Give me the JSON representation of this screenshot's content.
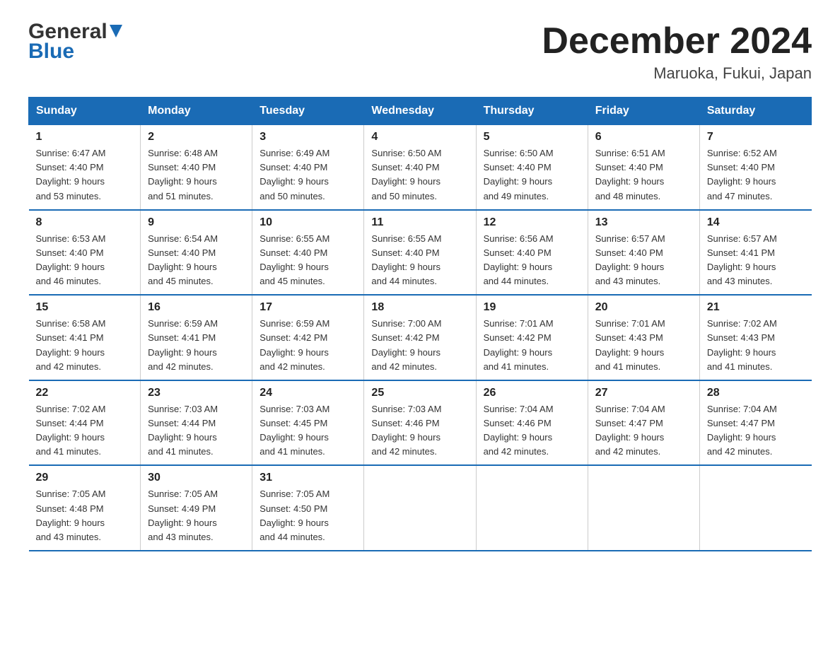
{
  "logo": {
    "general": "General",
    "blue": "Blue"
  },
  "title": "December 2024",
  "location": "Maruoka, Fukui, Japan",
  "days_of_week": [
    "Sunday",
    "Monday",
    "Tuesday",
    "Wednesday",
    "Thursday",
    "Friday",
    "Saturday"
  ],
  "weeks": [
    [
      {
        "day": "1",
        "sunrise": "6:47 AM",
        "sunset": "4:40 PM",
        "daylight": "9 hours and 53 minutes."
      },
      {
        "day": "2",
        "sunrise": "6:48 AM",
        "sunset": "4:40 PM",
        "daylight": "9 hours and 51 minutes."
      },
      {
        "day": "3",
        "sunrise": "6:49 AM",
        "sunset": "4:40 PM",
        "daylight": "9 hours and 50 minutes."
      },
      {
        "day": "4",
        "sunrise": "6:50 AM",
        "sunset": "4:40 PM",
        "daylight": "9 hours and 50 minutes."
      },
      {
        "day": "5",
        "sunrise": "6:50 AM",
        "sunset": "4:40 PM",
        "daylight": "9 hours and 49 minutes."
      },
      {
        "day": "6",
        "sunrise": "6:51 AM",
        "sunset": "4:40 PM",
        "daylight": "9 hours and 48 minutes."
      },
      {
        "day": "7",
        "sunrise": "6:52 AM",
        "sunset": "4:40 PM",
        "daylight": "9 hours and 47 minutes."
      }
    ],
    [
      {
        "day": "8",
        "sunrise": "6:53 AM",
        "sunset": "4:40 PM",
        "daylight": "9 hours and 46 minutes."
      },
      {
        "day": "9",
        "sunrise": "6:54 AM",
        "sunset": "4:40 PM",
        "daylight": "9 hours and 45 minutes."
      },
      {
        "day": "10",
        "sunrise": "6:55 AM",
        "sunset": "4:40 PM",
        "daylight": "9 hours and 45 minutes."
      },
      {
        "day": "11",
        "sunrise": "6:55 AM",
        "sunset": "4:40 PM",
        "daylight": "9 hours and 44 minutes."
      },
      {
        "day": "12",
        "sunrise": "6:56 AM",
        "sunset": "4:40 PM",
        "daylight": "9 hours and 44 minutes."
      },
      {
        "day": "13",
        "sunrise": "6:57 AM",
        "sunset": "4:40 PM",
        "daylight": "9 hours and 43 minutes."
      },
      {
        "day": "14",
        "sunrise": "6:57 AM",
        "sunset": "4:41 PM",
        "daylight": "9 hours and 43 minutes."
      }
    ],
    [
      {
        "day": "15",
        "sunrise": "6:58 AM",
        "sunset": "4:41 PM",
        "daylight": "9 hours and 42 minutes."
      },
      {
        "day": "16",
        "sunrise": "6:59 AM",
        "sunset": "4:41 PM",
        "daylight": "9 hours and 42 minutes."
      },
      {
        "day": "17",
        "sunrise": "6:59 AM",
        "sunset": "4:42 PM",
        "daylight": "9 hours and 42 minutes."
      },
      {
        "day": "18",
        "sunrise": "7:00 AM",
        "sunset": "4:42 PM",
        "daylight": "9 hours and 42 minutes."
      },
      {
        "day": "19",
        "sunrise": "7:01 AM",
        "sunset": "4:42 PM",
        "daylight": "9 hours and 41 minutes."
      },
      {
        "day": "20",
        "sunrise": "7:01 AM",
        "sunset": "4:43 PM",
        "daylight": "9 hours and 41 minutes."
      },
      {
        "day": "21",
        "sunrise": "7:02 AM",
        "sunset": "4:43 PM",
        "daylight": "9 hours and 41 minutes."
      }
    ],
    [
      {
        "day": "22",
        "sunrise": "7:02 AM",
        "sunset": "4:44 PM",
        "daylight": "9 hours and 41 minutes."
      },
      {
        "day": "23",
        "sunrise": "7:03 AM",
        "sunset": "4:44 PM",
        "daylight": "9 hours and 41 minutes."
      },
      {
        "day": "24",
        "sunrise": "7:03 AM",
        "sunset": "4:45 PM",
        "daylight": "9 hours and 41 minutes."
      },
      {
        "day": "25",
        "sunrise": "7:03 AM",
        "sunset": "4:46 PM",
        "daylight": "9 hours and 42 minutes."
      },
      {
        "day": "26",
        "sunrise": "7:04 AM",
        "sunset": "4:46 PM",
        "daylight": "9 hours and 42 minutes."
      },
      {
        "day": "27",
        "sunrise": "7:04 AM",
        "sunset": "4:47 PM",
        "daylight": "9 hours and 42 minutes."
      },
      {
        "day": "28",
        "sunrise": "7:04 AM",
        "sunset": "4:47 PM",
        "daylight": "9 hours and 42 minutes."
      }
    ],
    [
      {
        "day": "29",
        "sunrise": "7:05 AM",
        "sunset": "4:48 PM",
        "daylight": "9 hours and 43 minutes."
      },
      {
        "day": "30",
        "sunrise": "7:05 AM",
        "sunset": "4:49 PM",
        "daylight": "9 hours and 43 minutes."
      },
      {
        "day": "31",
        "sunrise": "7:05 AM",
        "sunset": "4:50 PM",
        "daylight": "9 hours and 44 minutes."
      },
      null,
      null,
      null,
      null
    ]
  ],
  "labels": {
    "sunrise": "Sunrise:",
    "sunset": "Sunset:",
    "daylight": "Daylight:"
  }
}
